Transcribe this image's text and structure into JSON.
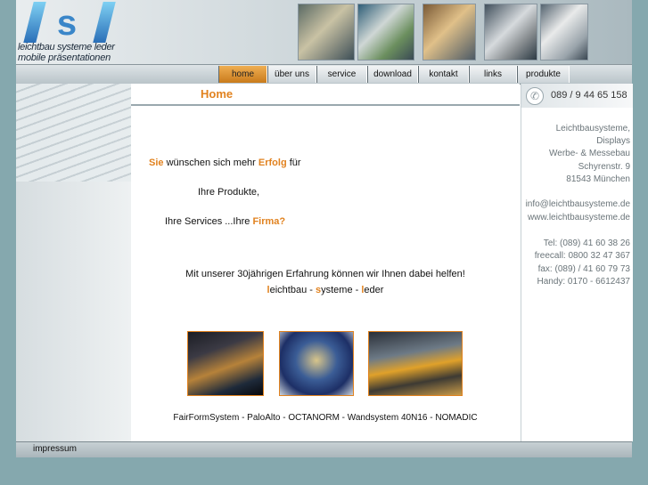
{
  "logo": {
    "mark": "/s/",
    "line1": "leichtbau systeme leder",
    "line2": "mobile präsentationen"
  },
  "header_thumbnails": [
    {
      "name": "exhibition-stand-photo-1"
    },
    {
      "name": "exhibition-stand-photo-2"
    },
    {
      "name": "exhibition-stand-photo-3"
    },
    {
      "name": "exhibition-stand-photo-4"
    },
    {
      "name": "exhibition-stand-photo-5"
    }
  ],
  "nav": {
    "items": [
      {
        "label": "home",
        "active": true
      },
      {
        "label": "über uns",
        "active": false
      },
      {
        "label": "service",
        "active": false
      },
      {
        "label": "download",
        "active": false
      },
      {
        "label": "kontakt",
        "active": false
      },
      {
        "label": "links",
        "active": false
      },
      {
        "label": "produkte",
        "active": false
      }
    ]
  },
  "page": {
    "title": "Home"
  },
  "main": {
    "line1_a": "Sie",
    "line1_b": " wünschen sich mehr ",
    "line1_c": "Erfolg",
    "line1_d": " für",
    "line2": "Ihre Produkte,",
    "line3_a": "Ihre Services ...Ihre ",
    "line3_b": "Firma?",
    "experience": "Mit unserer 30jährigen Erfahrung können wir Ihnen dabei helfen!",
    "brand_l": "l",
    "brand_1": "eichtbau - ",
    "brand_s": "s",
    "brand_2": "ysteme - ",
    "brand_l2": "l",
    "brand_3": "eder",
    "systems": "FairFormSystem - PaloAlto - OCTANORM - Wandsystem 40N16 - NOMADIC"
  },
  "contact": {
    "phone": "089 / 9 44 65 158",
    "company1": "Leichtbausysteme,",
    "company2": "Displays",
    "company3": "Werbe- & Messebau",
    "street": "Schyrenstr. 9",
    "city": "81543 München",
    "email": "info@leichtbausysteme.de",
    "web": "www.leichtbausysteme.de",
    "tel": "Tel: (089) 41 60 38 26",
    "freecall": "freecall: 0800 32 47 367",
    "fax": "fax: (089) / 41 60 79 73",
    "handy": "Handy: 0170 - 6612437"
  },
  "footer": {
    "impressum": "impressum"
  },
  "colors": {
    "accent": "#e1821f",
    "background": "#85a8ae",
    "nav_active": "#d98a2a"
  }
}
